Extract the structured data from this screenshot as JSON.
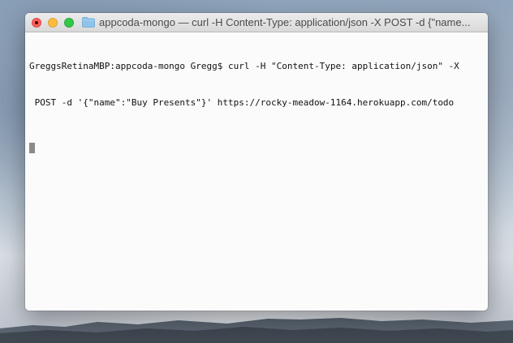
{
  "window": {
    "title": "appcoda-mongo — curl -H Content-Type: application/json -X POST -d {\"name...",
    "folder_icon": "folder-icon",
    "controls": {
      "close": "close-button",
      "minimize": "minimize-button",
      "zoom": "zoom-button"
    }
  },
  "terminal": {
    "lines": [
      "GreggsRetinaMBP:appcoda-mongo Gregg$ curl -H \"Content-Type: application/json\" -X",
      " POST -d '{\"name\":\"Buy Presents\"}' https://rocky-meadow-1164.herokuapp.com/todo"
    ]
  },
  "colors": {
    "close": "#fc605c",
    "minimize": "#fdbc40",
    "zoom": "#34c84a",
    "folder": "#8fc3ea"
  }
}
